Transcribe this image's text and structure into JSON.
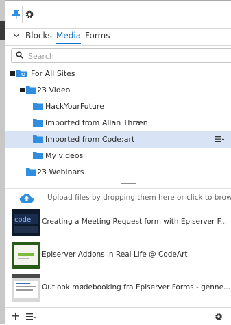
{
  "tabs": {
    "blocks": "Blocks",
    "media": "Media",
    "forms": "Forms"
  },
  "search": {
    "placeholder": "Search"
  },
  "tree": {
    "root": "For All Sites",
    "video": "23 Video",
    "hyf": "HackYourFuture",
    "allan": "Imported from Allan Thræn",
    "codeart": "Imported from Code:art",
    "myvideos": "My videos",
    "webinars": "23 Webinars"
  },
  "upload": {
    "text": "Upload files by dropping them here or click to browse"
  },
  "media_items": [
    {
      "title": "Creating a Meeting Request form with Episerver F..."
    },
    {
      "title": "Episerver Addons in Real Life @ CodeArt"
    },
    {
      "title": "Outlook mødebooking fra Episerver Forms - genne..."
    }
  ],
  "colors": {
    "accent": "#0f6ecd",
    "folder": "#2f8ee0",
    "selected_row": "#d8e4f6"
  }
}
